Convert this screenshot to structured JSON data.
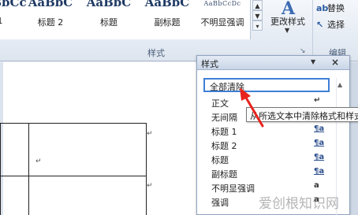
{
  "ribbon": {
    "gallery": [
      {
        "preview": "AaBbCc",
        "name": "1"
      },
      {
        "preview": "AaBbC",
        "name": "标题 2"
      },
      {
        "preview": "AaBbC",
        "name": "标题"
      },
      {
        "preview": "AaBbC",
        "name": "副标题"
      },
      {
        "preview": "AaBbCcDc",
        "name": "不明显强调"
      }
    ],
    "change_styles": "更改样式",
    "group_label": "样式",
    "editing": {
      "replace": "替换",
      "select": "选择",
      "label": "编辑"
    }
  },
  "styles_pane": {
    "title": "样式",
    "items": [
      {
        "name": "全部清除",
        "indicator": ""
      },
      {
        "name": "正文",
        "indicator": "↵"
      },
      {
        "name": "无间隔",
        "indicator": "↵"
      },
      {
        "name": "标题 1",
        "indicator": "¶a"
      },
      {
        "name": "标题 2",
        "indicator": "¶a"
      },
      {
        "name": "标题",
        "indicator": "¶a"
      },
      {
        "name": "副标题",
        "indicator": "¶a"
      },
      {
        "name": "不明显强调",
        "indicator": "a"
      },
      {
        "name": "强调",
        "indicator": "a"
      }
    ]
  },
  "tooltip": "从所选文本中清除格式和样式",
  "watermark": "爱创根知识网",
  "colors": {
    "accent": "#3f7fd6",
    "arrow": "#e8231e"
  }
}
